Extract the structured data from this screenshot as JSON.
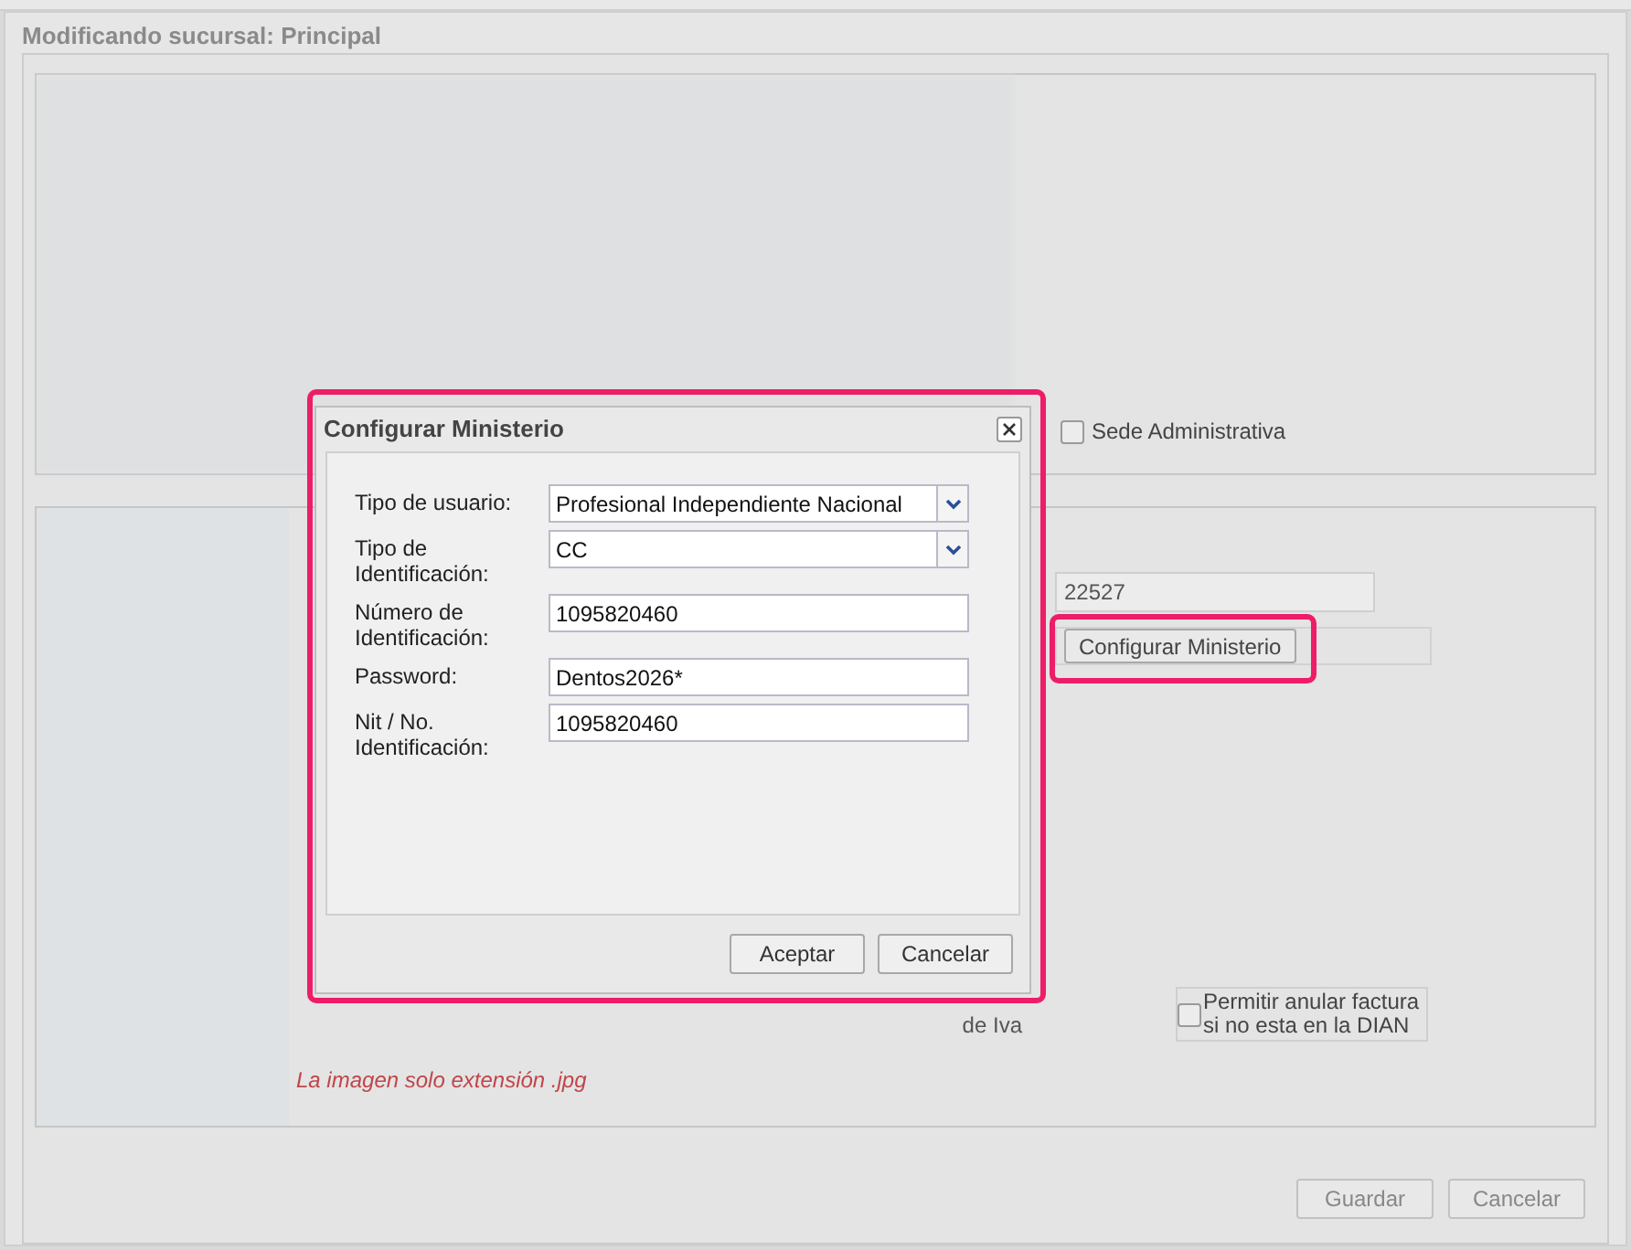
{
  "window": {
    "title": "Modificando sucursal: Principal"
  },
  "branch_panel": {
    "checkboxes": [
      {
        "label": "Sede Administrativa",
        "checked": false
      }
    ]
  },
  "settings_panel": {
    "field_value": "22527",
    "configure_button": "Configurar Ministerio",
    "checkboxes": [
      {
        "label": "Permitir anular factura si no esta en la DIAN",
        "checked": false
      }
    ],
    "partial_label": "de Iva",
    "image_note": "La imagen solo extensión .jpg"
  },
  "dialog": {
    "title": "Configurar Ministerio",
    "fields": [
      {
        "kind": "select",
        "label": "Tipo de usuario:",
        "value": "Profesional Independiente Nacional"
      },
      {
        "kind": "select",
        "label": "Tipo de Identificación:",
        "value": "CC"
      },
      {
        "kind": "text",
        "label": "Número de Identificación:",
        "value": "1095820460"
      },
      {
        "kind": "text",
        "label": "Password:",
        "value": "Dentos2026*"
      },
      {
        "kind": "text",
        "label": "Nit / No. Identificación:",
        "value": "1095820460"
      }
    ],
    "buttons": [
      "Aceptar",
      "Cancelar"
    ]
  },
  "footer": {
    "buttons": [
      "Guardar",
      "Cancelar"
    ]
  }
}
